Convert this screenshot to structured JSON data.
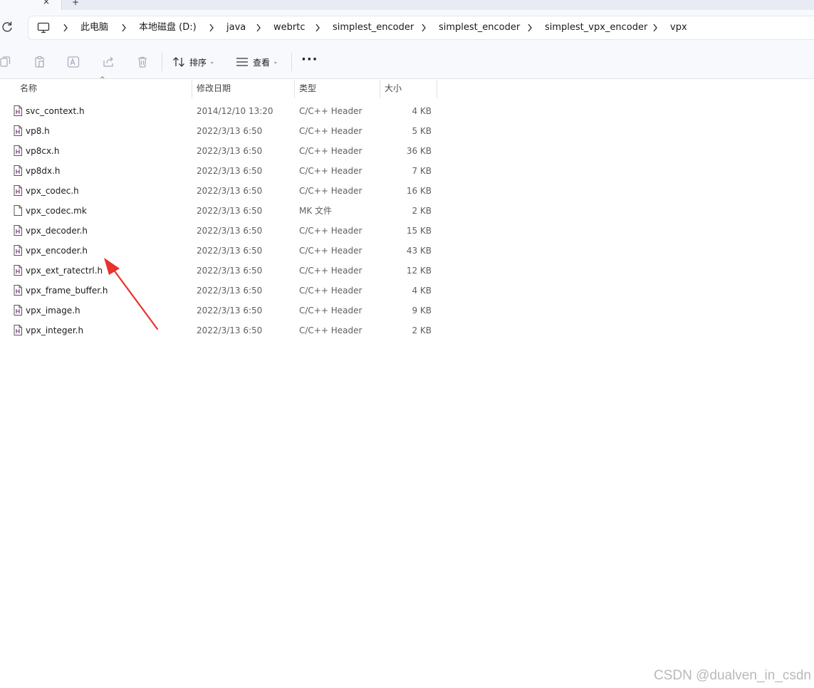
{
  "tab_strip": {
    "close_glyph": "×",
    "new_tab_glyph": "+"
  },
  "address_bar": {
    "root_icon": "this-pc-icon",
    "crumbs": [
      "此电脑",
      "本地磁盘 (D:)",
      "java",
      "webrtc",
      "simplest_encoder",
      "simplest_encoder",
      "simplest_vpx_encoder",
      "vpx"
    ]
  },
  "toolbar": {
    "sort_label": "排序",
    "view_label": "查看",
    "more_label": "···"
  },
  "columns": {
    "name": "名称",
    "modified": "修改日期",
    "type": "类型",
    "size": "大小"
  },
  "files": [
    {
      "name": "svc_context.h",
      "modified": "2014/12/10 13:20",
      "type": "C/C++ Header",
      "size": "4 KB",
      "icon": "header-file-icon"
    },
    {
      "name": "vp8.h",
      "modified": "2022/3/13 6:50",
      "type": "C/C++ Header",
      "size": "5 KB",
      "icon": "header-file-icon"
    },
    {
      "name": "vp8cx.h",
      "modified": "2022/3/13 6:50",
      "type": "C/C++ Header",
      "size": "36 KB",
      "icon": "header-file-icon"
    },
    {
      "name": "vp8dx.h",
      "modified": "2022/3/13 6:50",
      "type": "C/C++ Header",
      "size": "7 KB",
      "icon": "header-file-icon"
    },
    {
      "name": "vpx_codec.h",
      "modified": "2022/3/13 6:50",
      "type": "C/C++ Header",
      "size": "16 KB",
      "icon": "header-file-icon"
    },
    {
      "name": "vpx_codec.mk",
      "modified": "2022/3/13 6:50",
      "type": "MK 文件",
      "size": "2 KB",
      "icon": "generic-file-icon"
    },
    {
      "name": "vpx_decoder.h",
      "modified": "2022/3/13 6:50",
      "type": "C/C++ Header",
      "size": "15 KB",
      "icon": "header-file-icon"
    },
    {
      "name": "vpx_encoder.h",
      "modified": "2022/3/13 6:50",
      "type": "C/C++ Header",
      "size": "43 KB",
      "icon": "header-file-icon"
    },
    {
      "name": "vpx_ext_ratectrl.h",
      "modified": "2022/3/13 6:50",
      "type": "C/C++ Header",
      "size": "12 KB",
      "icon": "header-file-icon"
    },
    {
      "name": "vpx_frame_buffer.h",
      "modified": "2022/3/13 6:50",
      "type": "C/C++ Header",
      "size": "4 KB",
      "icon": "header-file-icon"
    },
    {
      "name": "vpx_image.h",
      "modified": "2022/3/13 6:50",
      "type": "C/C++ Header",
      "size": "9 KB",
      "icon": "header-file-icon"
    },
    {
      "name": "vpx_integer.h",
      "modified": "2022/3/13 6:50",
      "type": "C/C++ Header",
      "size": "2 KB",
      "icon": "header-file-icon"
    }
  ],
  "annotation": {
    "color": "#e8322b"
  },
  "watermark": "CSDN @dualven_in_csdn"
}
